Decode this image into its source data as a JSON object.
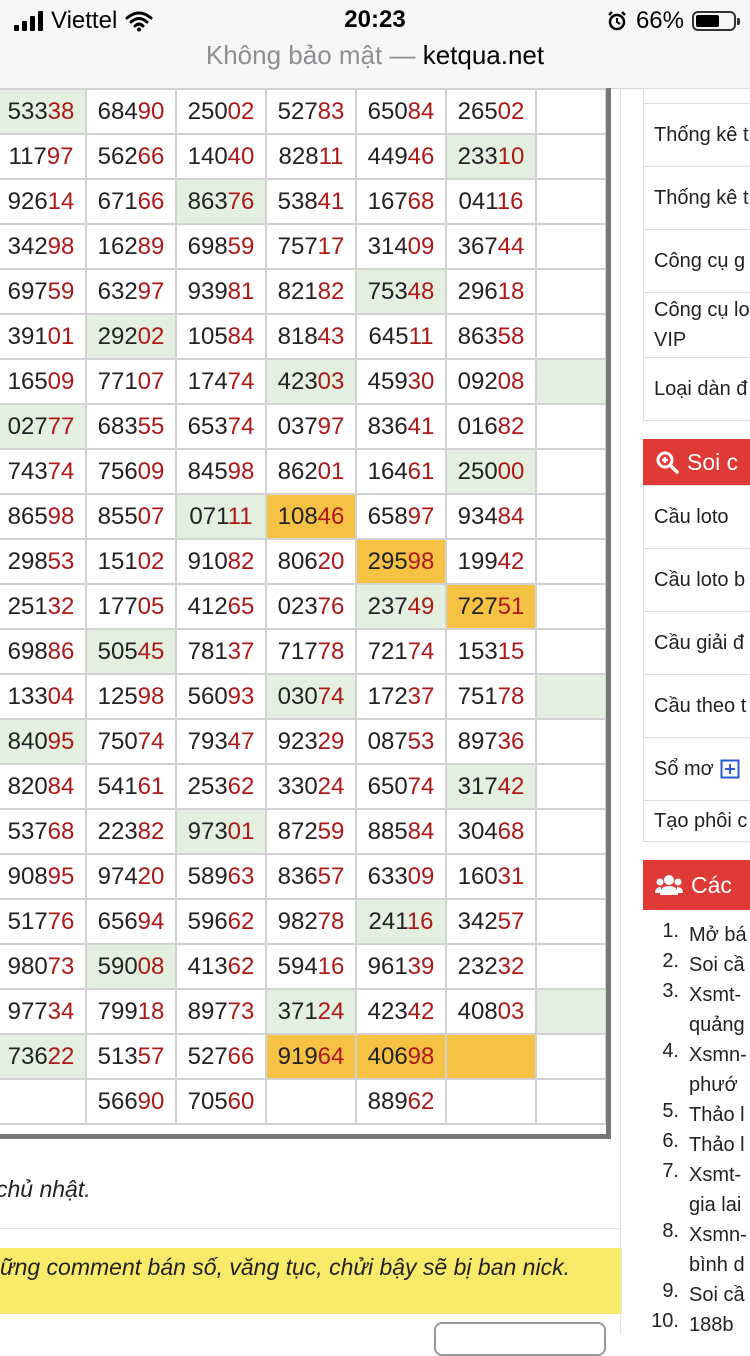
{
  "status_bar": {
    "carrier": "Viettel",
    "time": "20:23",
    "battery": "66%",
    "battery_level": 0.66
  },
  "address_bar": {
    "insecure_label": "Không bảo mật —",
    "domain": "ketqua.net"
  },
  "results_table": {
    "rows": [
      [
        "53338",
        "68490",
        "25002",
        "52783",
        "65084",
        "26502",
        ""
      ],
      [
        "11797",
        "56266",
        "14040",
        "82811",
        "44946",
        "23310",
        ""
      ],
      [
        "92614",
        "67166",
        "86376",
        "53841",
        "16768",
        "04116",
        ""
      ],
      [
        "34298",
        "16289",
        "69859",
        "75717",
        "31409",
        "36744",
        ""
      ],
      [
        "69759",
        "63297",
        "93981",
        "82182",
        "75348",
        "29618",
        ""
      ],
      [
        "39101",
        "29202",
        "10584",
        "81843",
        "64511",
        "86358",
        ""
      ],
      [
        "16509",
        "77107",
        "17474",
        "42303",
        "45930",
        "09208",
        ""
      ],
      [
        "02777",
        "68355",
        "65374",
        "03797",
        "83641",
        "01682",
        ""
      ],
      [
        "74374",
        "75609",
        "84598",
        "86201",
        "16461",
        "25000",
        ""
      ],
      [
        "86598",
        "85507",
        "07111",
        "10846",
        "65897",
        "93484",
        ""
      ],
      [
        "29853",
        "15102",
        "91082",
        "80620",
        "29598",
        "19942",
        ""
      ],
      [
        "25132",
        "17705",
        "41265",
        "02376",
        "23749",
        "72751",
        ""
      ],
      [
        "69886",
        "50545",
        "78137",
        "71778",
        "72174",
        "15315",
        ""
      ],
      [
        "13304",
        "12598",
        "56093",
        "03074",
        "17237",
        "75178",
        ""
      ],
      [
        "84095",
        "75074",
        "79347",
        "92329",
        "08753",
        "89736",
        ""
      ],
      [
        "82084",
        "54161",
        "25362",
        "33024",
        "65074",
        "31742",
        ""
      ],
      [
        "53768",
        "22382",
        "97301",
        "87259",
        "88584",
        "30468",
        ""
      ],
      [
        "90895",
        "97420",
        "58963",
        "83657",
        "63309",
        "16031",
        ""
      ],
      [
        "51776",
        "65694",
        "59662",
        "98278",
        "24116",
        "34257",
        ""
      ],
      [
        "98073",
        "59008",
        "41362",
        "59416",
        "96139",
        "23232",
        ""
      ],
      [
        "97734",
        "79918",
        "89773",
        "37124",
        "42342",
        "40803",
        ""
      ],
      [
        "73622",
        "51357",
        "52766",
        "91964",
        "40698",
        "",
        ""
      ],
      [
        "",
        "56690",
        "70560",
        "",
        "88962",
        "",
        ""
      ]
    ],
    "highlights": [
      [
        "g",
        "",
        "",
        "",
        "",
        "",
        ""
      ],
      [
        "",
        "",
        "",
        "",
        "",
        "g",
        ""
      ],
      [
        "",
        "",
        "g",
        "",
        "",
        "",
        ""
      ],
      [
        "",
        "",
        "",
        "",
        "",
        "",
        ""
      ],
      [
        "",
        "",
        "",
        "",
        "g",
        "",
        ""
      ],
      [
        "",
        "g",
        "",
        "",
        "",
        "",
        ""
      ],
      [
        "",
        "",
        "",
        "g",
        "",
        "",
        "g"
      ],
      [
        "g",
        "",
        "",
        "",
        "",
        "",
        ""
      ],
      [
        "",
        "",
        "",
        "",
        "",
        "g",
        ""
      ],
      [
        "",
        "",
        "g",
        "o",
        "",
        "",
        ""
      ],
      [
        "",
        "",
        "",
        "",
        "o",
        "",
        ""
      ],
      [
        "",
        "",
        "",
        "",
        "g",
        "o",
        ""
      ],
      [
        "",
        "g",
        "",
        "",
        "",
        "",
        ""
      ],
      [
        "",
        "",
        "",
        "g",
        "",
        "",
        "g"
      ],
      [
        "g",
        "",
        "",
        "",
        "",
        "",
        ""
      ],
      [
        "",
        "",
        "",
        "",
        "",
        "g",
        ""
      ],
      [
        "",
        "",
        "g",
        "",
        "",
        "",
        ""
      ],
      [
        "",
        "",
        "",
        "",
        "",
        "",
        ""
      ],
      [
        "",
        "",
        "",
        "",
        "g",
        "",
        ""
      ],
      [
        "",
        "g",
        "",
        "",
        "",
        "",
        ""
      ],
      [
        "",
        "",
        "",
        "g",
        "",
        "",
        "g"
      ],
      [
        "g",
        "",
        "",
        "o",
        "o",
        "o",
        ""
      ],
      [
        "",
        "",
        "",
        "",
        "",
        "",
        ""
      ]
    ],
    "colors": {
      "tail_digits": "#b01818",
      "green_cell": "#e3f0df",
      "orange_cell": "#f6c244"
    }
  },
  "note_text": "chủ nhật.",
  "warning_text": "ững comment bán số, văng tục, chửi bậy sẽ bị ban nick.",
  "sidebar": {
    "menu_items": [
      "Thống kê t",
      "Thống kê t",
      "Công cụ g",
      "Công cụ lo",
      "VIP",
      "Loại dàn đ"
    ],
    "soi_header": "Soi c",
    "soi_items": [
      "Cầu loto",
      "Cầu loto b",
      "Cầu giải đ",
      "Cầu theo t",
      "Sổ mơ",
      "Tạo phôi c"
    ],
    "cac_header": "Các",
    "links": [
      {
        "num": "1.",
        "lines": [
          "Mở bá"
        ]
      },
      {
        "num": "2.",
        "lines": [
          "Soi cầ"
        ]
      },
      {
        "num": "3.",
        "lines": [
          "Xsmt-",
          "quảng"
        ]
      },
      {
        "num": "4.",
        "lines": [
          "Xsmn-",
          "phướ"
        ]
      },
      {
        "num": "5.",
        "lines": [
          "Thảo l"
        ]
      },
      {
        "num": "6.",
        "lines": [
          "Thảo l"
        ]
      },
      {
        "num": "7.",
        "lines": [
          "Xsmt-",
          "gia lai"
        ]
      },
      {
        "num": "8.",
        "lines": [
          "Xsmn-",
          "bình d"
        ]
      },
      {
        "num": "9.",
        "lines": [
          "Soi cầ"
        ]
      },
      {
        "num": "10.",
        "lines": [
          "188b"
        ]
      }
    ],
    "colors": {
      "header_bg": "#e03a36",
      "header_text": "#ffffff",
      "plus_icon": "#2a5bd7"
    }
  }
}
